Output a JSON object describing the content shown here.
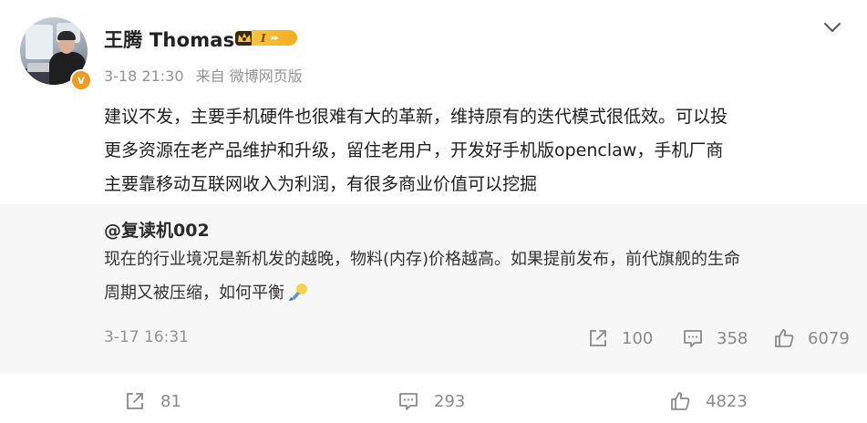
{
  "post": {
    "author": "王腾 Thomas",
    "verified_mark": "v",
    "level_label": "I",
    "time": "3-18 21:30",
    "source": "来自 微博网页版",
    "text_lines": [
      "建议不发，主要手机硬件也很难有大的革新，维持原有的迭代模式很低效。可以投",
      "更多资源在老产品维护和升级，留住老用户，开发好手机版openclaw，手机厂商",
      "主要靠移动互联网收入为利润，有很多商业价值可以挖掘"
    ],
    "actions": {
      "repost": "81",
      "comment": "293",
      "like": "4823"
    }
  },
  "repost": {
    "author": "@复读机002",
    "text_lines": [
      "现在的行业境况是新机发的越晚，物料(内存)价格越高。如果提前发布，前代旗舰的生命",
      "周期又被压缩，如何平衡"
    ],
    "emoji": "lightbulb-emoji",
    "time": "3-17 16:31",
    "actions": {
      "repost": "100",
      "comment": "358",
      "like": "6079"
    }
  },
  "icons": [
    "chevron-down-icon",
    "repost-icon",
    "comment-icon",
    "like-icon",
    "crown-icon"
  ],
  "colors": {
    "accent": "#f29a1b",
    "muted": "#939393",
    "repost_bg": "#f7f7f7"
  }
}
